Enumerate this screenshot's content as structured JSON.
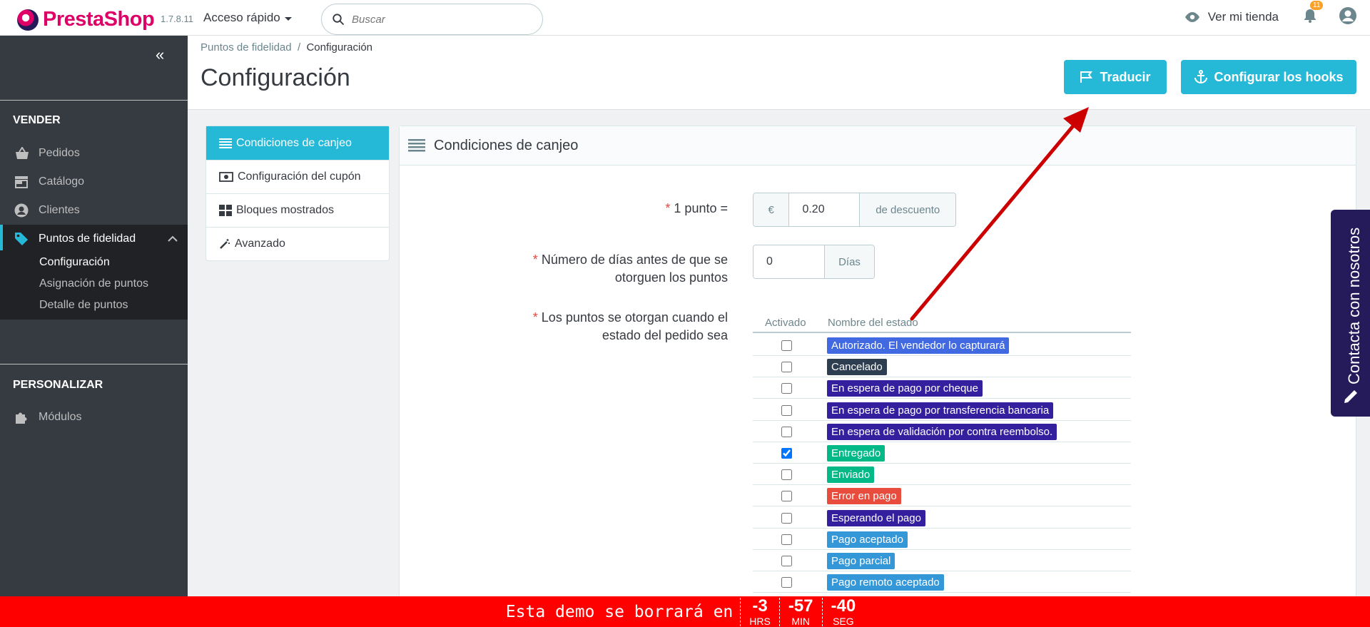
{
  "header": {
    "brand": "PrestaShop",
    "version": "1.7.8.11",
    "quick_access": "Acceso rápido",
    "search_placeholder": "Buscar",
    "store_link": "Ver mi tienda",
    "notifications_count": "11"
  },
  "sidebar": {
    "section_sell": "VENDER",
    "items": [
      {
        "label": "Pedidos",
        "icon": "basket-icon"
      },
      {
        "label": "Catálogo",
        "icon": "store-icon"
      },
      {
        "label": "Clientes",
        "icon": "account-icon"
      },
      {
        "label": "Puntos de fidelidad",
        "icon": "tag-icon"
      }
    ],
    "submenu": [
      "Configuración",
      "Asignación de puntos",
      "Detalle de puntos"
    ],
    "section_customize": "PERSONALIZAR",
    "modules": "Módulos"
  },
  "page": {
    "breadcrumb_parent": "Puntos de fidelidad",
    "breadcrumb_sep": "/",
    "breadcrumb_current": "Configuración",
    "title": "Configuración",
    "btn_translate": "Traducir",
    "btn_hooks": "Configurar los hooks"
  },
  "tabs": [
    {
      "label": "Condiciones de canjeo",
      "icon": "list-icon"
    },
    {
      "label": "Configuración del cupón",
      "icon": "money-icon"
    },
    {
      "label": "Bloques mostrados",
      "icon": "grid-icon"
    },
    {
      "label": "Avanzado",
      "icon": "wand-icon"
    }
  ],
  "panel": {
    "title": "Condiciones de canjeo",
    "req": "*",
    "point_label": "1 punto =",
    "currency": "€",
    "point_value": "0.20",
    "discount_suffix": "de descuento",
    "days_label_1": "Número de días antes de que se",
    "days_label_2": "otorguen los puntos",
    "days_value": "0",
    "days_suffix": "Días",
    "states_label_1": "Los puntos se otorgan cuando el",
    "states_label_2": "estado del pedido sea",
    "col_enabled": "Activado",
    "col_state": "Nombre del estado"
  },
  "states": [
    {
      "name": "Autorizado. El vendedor lo capturará",
      "color": "#4169e1",
      "checked": false
    },
    {
      "name": "Cancelado",
      "color": "#2c3e50",
      "checked": false
    },
    {
      "name": "En espera de pago por cheque",
      "color": "#34209e",
      "checked": false
    },
    {
      "name": "En espera de pago por transferencia bancaria",
      "color": "#34209e",
      "checked": false
    },
    {
      "name": "En espera de validación por contra reembolso.",
      "color": "#34209e",
      "checked": false
    },
    {
      "name": "Entregado",
      "color": "#01b887",
      "checked": true
    },
    {
      "name": "Enviado",
      "color": "#01b887",
      "checked": false
    },
    {
      "name": "Error en pago",
      "color": "#e74c3c",
      "checked": false
    },
    {
      "name": "Esperando el pago",
      "color": "#34209e",
      "checked": false
    },
    {
      "name": "Pago aceptado",
      "color": "#3498d8",
      "checked": false
    },
    {
      "name": "Pago parcial",
      "color": "#3498d8",
      "checked": false
    },
    {
      "name": "Pago remoto aceptado",
      "color": "#3498d8",
      "checked": false
    }
  ],
  "contact": "Contacta con nosotros",
  "demo": {
    "text": "Esta demo se borrará en",
    "hours": "-3",
    "hours_unit": "HRS",
    "minutes": "-57",
    "minutes_unit": "MIN",
    "seconds": "-40",
    "seconds_unit": "SEG"
  },
  "colors": {
    "accent": "#25b9d7",
    "sidebar": "#363a41",
    "demo_bar": "#ff0000"
  }
}
